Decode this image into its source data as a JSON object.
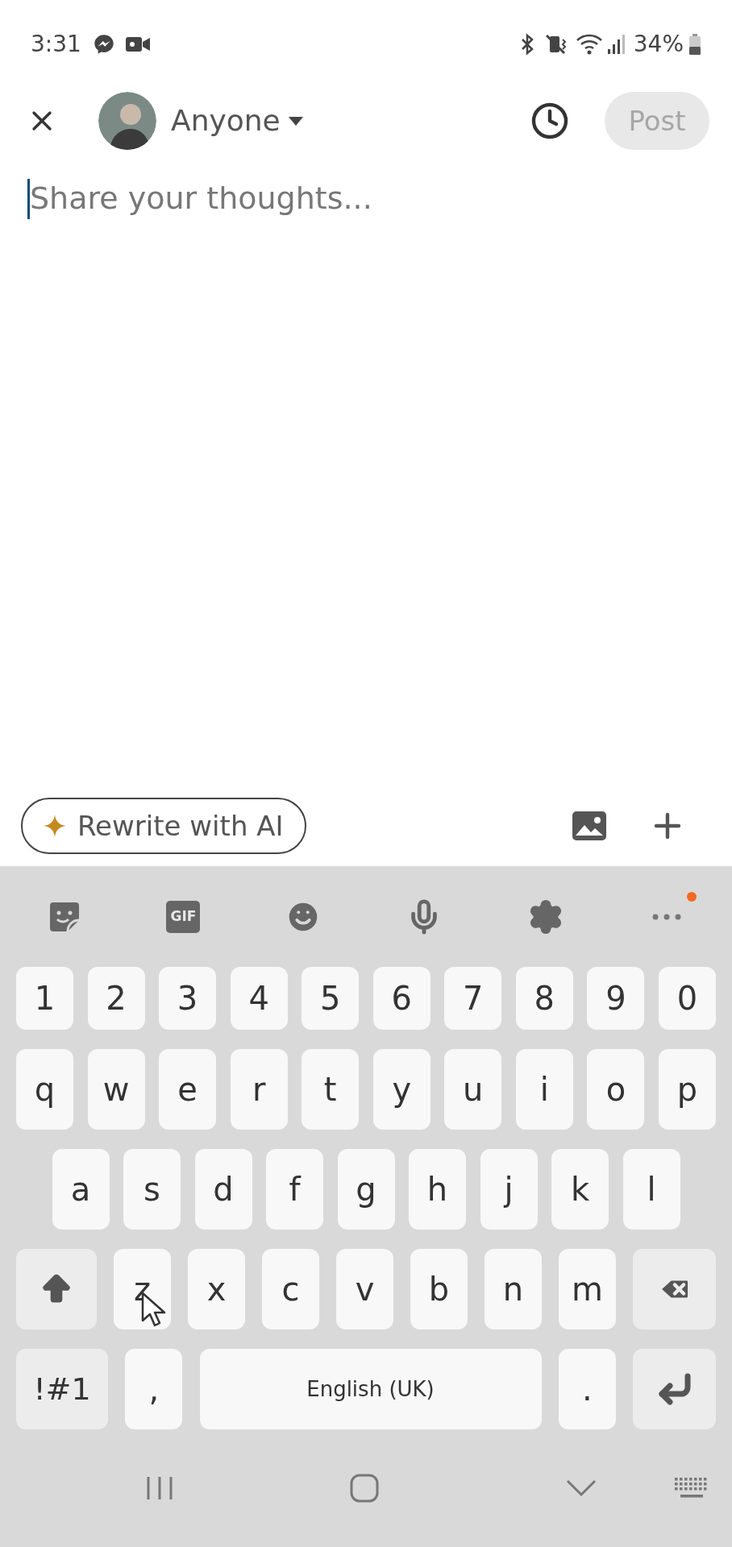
{
  "status_bar": {
    "time": "3:31",
    "battery": "34%"
  },
  "header": {
    "audience": "Anyone",
    "post_button": {
      "label": "Post",
      "disabled": true
    }
  },
  "composer": {
    "placeholder": "Share your thoughts..."
  },
  "actions": {
    "rewrite_button": "Rewrite with AI"
  },
  "keyboard": {
    "toolbar": {
      "gif_label": "GIF"
    },
    "rows": [
      {
        "keys": [
          {
            "kind": "char",
            "label": "1"
          },
          {
            "kind": "char",
            "label": "2"
          },
          {
            "kind": "char",
            "label": "3"
          },
          {
            "kind": "char",
            "label": "4"
          },
          {
            "kind": "char",
            "label": "5"
          },
          {
            "kind": "char",
            "label": "6"
          },
          {
            "kind": "char",
            "label": "7"
          },
          {
            "kind": "char",
            "label": "8"
          },
          {
            "kind": "char",
            "label": "9"
          },
          {
            "kind": "char",
            "label": "0"
          }
        ]
      },
      {
        "keys": [
          {
            "kind": "char",
            "label": "q"
          },
          {
            "kind": "char",
            "label": "w"
          },
          {
            "kind": "char",
            "label": "e"
          },
          {
            "kind": "char",
            "label": "r"
          },
          {
            "kind": "char",
            "label": "t"
          },
          {
            "kind": "char",
            "label": "y"
          },
          {
            "kind": "char",
            "label": "u"
          },
          {
            "kind": "char",
            "label": "i"
          },
          {
            "kind": "char",
            "label": "o"
          },
          {
            "kind": "char",
            "label": "p"
          }
        ]
      },
      {
        "keys": [
          {
            "kind": "char",
            "label": "a"
          },
          {
            "kind": "char",
            "label": "s"
          },
          {
            "kind": "char",
            "label": "d"
          },
          {
            "kind": "char",
            "label": "f"
          },
          {
            "kind": "char",
            "label": "g"
          },
          {
            "kind": "char",
            "label": "h"
          },
          {
            "kind": "char",
            "label": "j"
          },
          {
            "kind": "char",
            "label": "k"
          },
          {
            "kind": "char",
            "label": "l"
          }
        ]
      },
      {
        "keys": [
          {
            "kind": "shift"
          },
          {
            "kind": "char",
            "label": "z"
          },
          {
            "kind": "char",
            "label": "x"
          },
          {
            "kind": "char",
            "label": "c"
          },
          {
            "kind": "char",
            "label": "v"
          },
          {
            "kind": "char",
            "label": "b"
          },
          {
            "kind": "char",
            "label": "n"
          },
          {
            "kind": "char",
            "label": "m"
          },
          {
            "kind": "backspace"
          }
        ]
      },
      {
        "keys": [
          {
            "kind": "symbols",
            "label": "!#1"
          },
          {
            "kind": "char",
            "label": ","
          },
          {
            "kind": "space",
            "label": "English (UK)"
          },
          {
            "kind": "char",
            "label": "."
          },
          {
            "kind": "enter"
          }
        ]
      }
    ]
  }
}
